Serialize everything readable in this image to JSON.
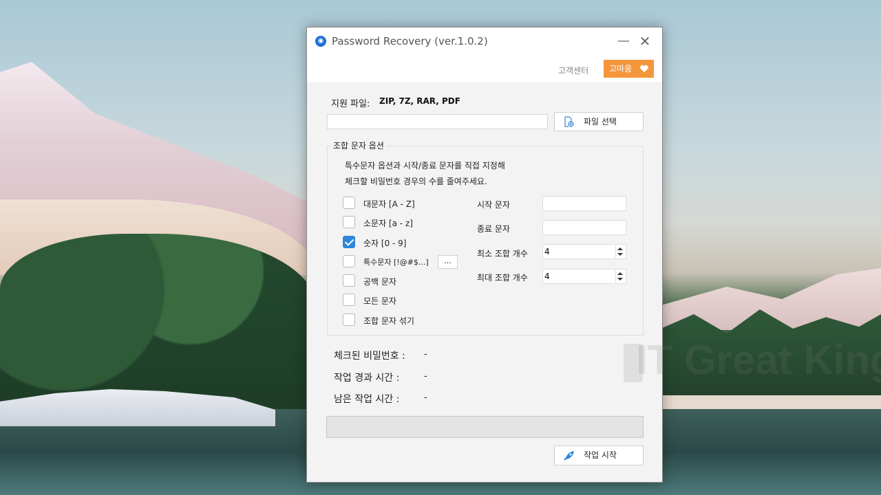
{
  "window": {
    "title": "Password Recovery (ver.1.0.2)",
    "min_glyph": "—",
    "close_glyph": "✕"
  },
  "header": {
    "support_label": "고객센터",
    "thanks_label": "고마움"
  },
  "file": {
    "supported_label": "지원 파일:",
    "supported_value": "ZIP, 7Z, RAR, PDF",
    "path_value": "",
    "select_button": "파일 선택"
  },
  "options": {
    "group_title": "조합 문자 옵션",
    "description_line1": "특수문자 옵션과 시작/종료 문자를 직접 지정해",
    "description_line2": "체크할 비밀번호 경우의 수를 줄여주세요.",
    "checkboxes": [
      {
        "label": "대문자 [A - Z]",
        "checked": false
      },
      {
        "label": "소문자 [a - z]",
        "checked": false
      },
      {
        "label": "숫자 [0 - 9]",
        "checked": true
      },
      {
        "label": "특수문자 [!@#$...]",
        "checked": false
      },
      {
        "label": "공백 문자",
        "checked": false
      },
      {
        "label": "모든 문자",
        "checked": false
      },
      {
        "label": "조합 문자 섞기",
        "checked": false
      }
    ],
    "special_button": "...",
    "start_char_label": "시작 문자",
    "start_char_value": "",
    "end_char_label": "종료 문자",
    "end_char_value": "",
    "min_count_label": "최소 조합 개수",
    "min_count_value": "4",
    "max_count_label": "최대 조합 개수",
    "max_count_value": "4"
  },
  "status": {
    "checked_label": "체크된 비밀번호 :",
    "checked_value": "-",
    "elapsed_label": "작업 경과 시간 :",
    "elapsed_value": "-",
    "remaining_label": "남은 작업 시간 :",
    "remaining_value": "-",
    "progress_percent": 0
  },
  "actions": {
    "start_button": "작업 시작"
  },
  "watermark": "IT Great King",
  "colors": {
    "accent_orange": "#f5963b",
    "checkbox_blue": "#2f86d9",
    "app_icon_blue": "#1e6fd6"
  }
}
